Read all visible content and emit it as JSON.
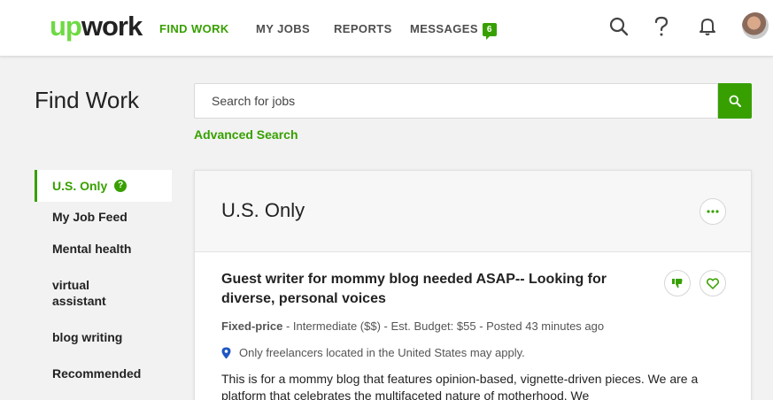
{
  "header": {
    "logo": {
      "g": "up",
      "d": "work"
    },
    "nav": [
      {
        "label": "FIND WORK"
      },
      {
        "label": "MY JOBS"
      },
      {
        "label": "REPORTS"
      },
      {
        "label": "MESSAGES",
        "badge": "6"
      }
    ],
    "icons": [
      "search-icon",
      "help-icon",
      "bell-icon",
      "avatar"
    ]
  },
  "page": {
    "title": "Find Work",
    "search_placeholder": "Search for jobs",
    "advanced_search": "Advanced Search"
  },
  "sidebar": {
    "items": [
      {
        "label": "U.S. Only",
        "help": "?"
      },
      {
        "label": "My Job Feed"
      },
      {
        "label": "Mental health"
      },
      {
        "label": "virtual assistant"
      },
      {
        "label": "blog writing"
      },
      {
        "label": "Recommended"
      }
    ]
  },
  "feed": {
    "title": "U.S. Only",
    "job": {
      "title": "Guest writer for mommy blog needed ASAP-- Looking for diverse, personal voices",
      "type": "Fixed-price",
      "details": " - Intermediate ($$) - Est. Budget: $55 - Posted 43 minutes ago",
      "location_note": "Only freelancers located in the United States may apply.",
      "description": "This is for a mommy blog that features opinion-based, vignette-driven pieces. We are a platform that celebrates the multifaceted nature of motherhood. We"
    }
  },
  "colors": {
    "accent": "#37a000",
    "logo_green": "#6fda44",
    "location_pin": "#1f57c3"
  }
}
